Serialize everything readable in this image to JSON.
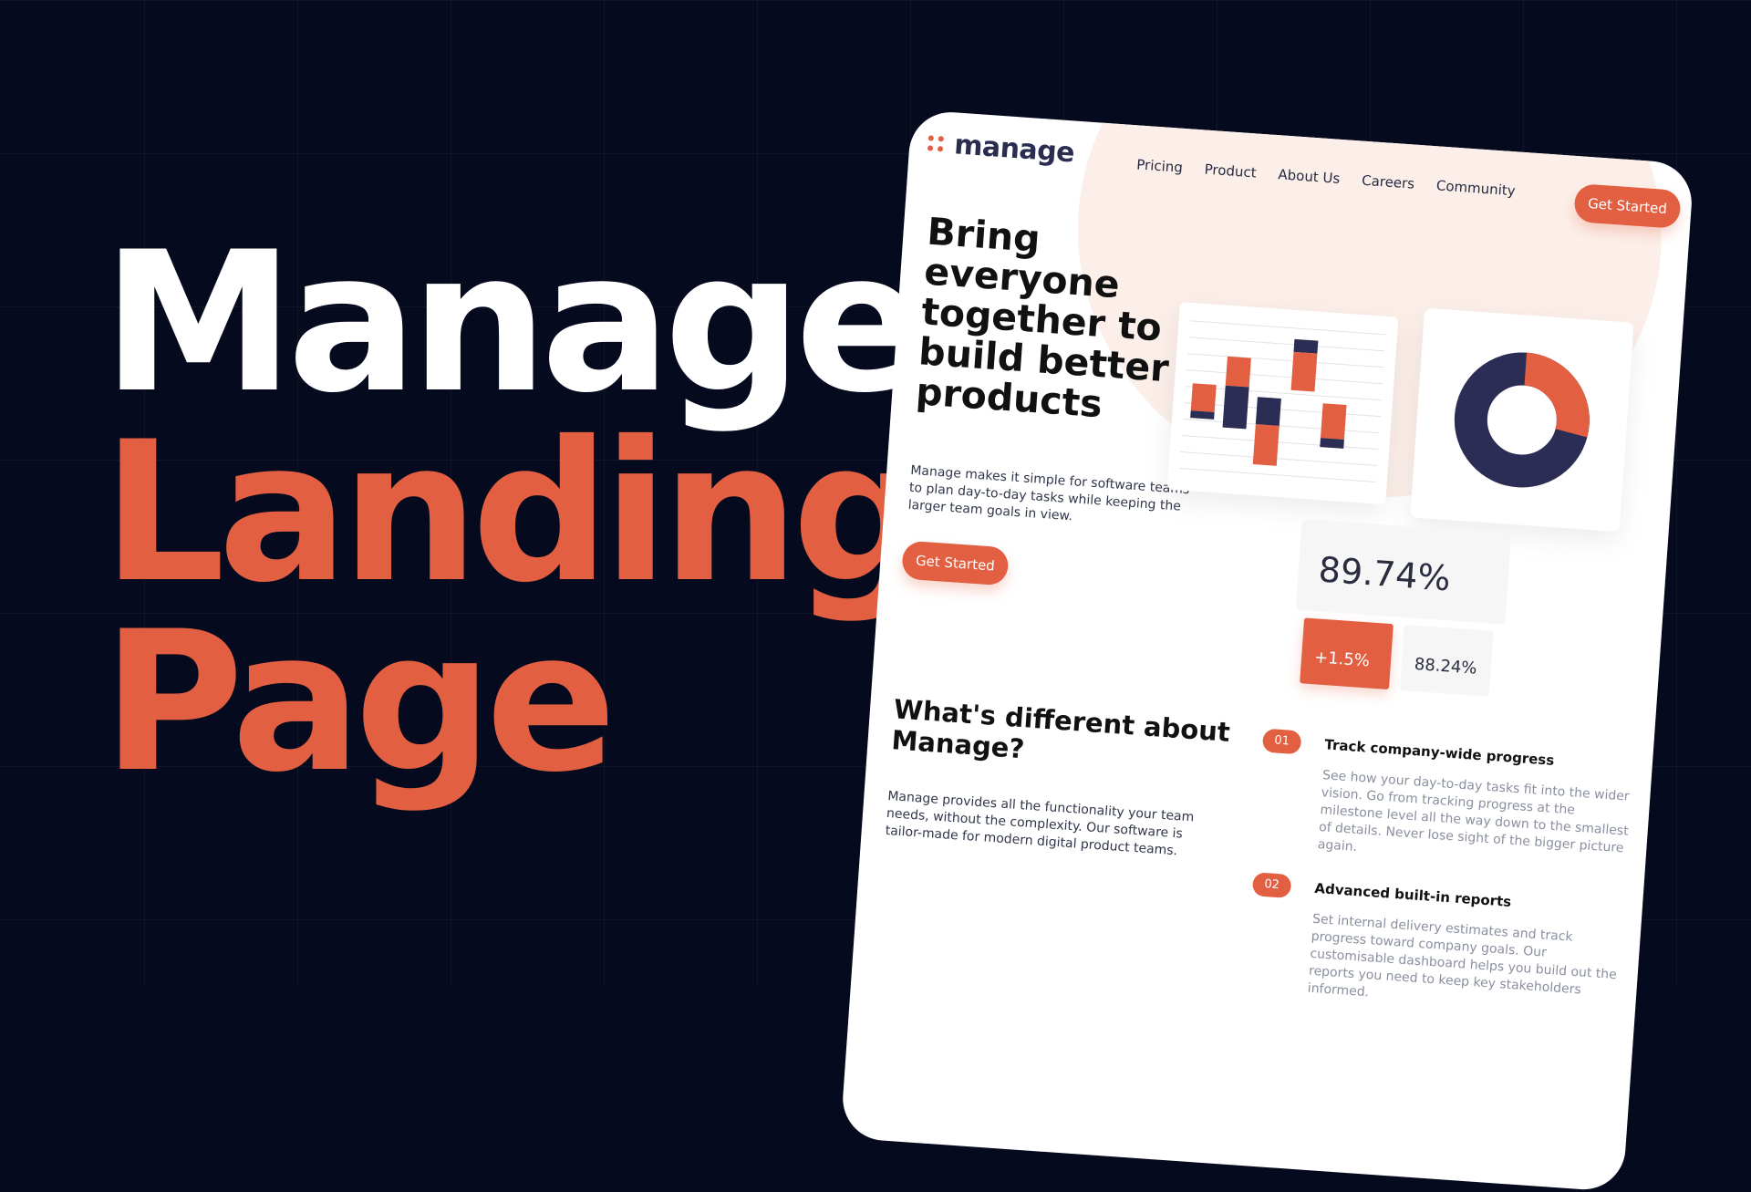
{
  "hero": {
    "line1": "Manage",
    "line2": "Landing",
    "line3": "Page"
  },
  "mockup": {
    "logo": "manage",
    "nav": [
      "Pricing",
      "Product",
      "About Us",
      "Careers",
      "Community"
    ],
    "cta_label": "Get Started",
    "headline": "Bring everyone together to build better products",
    "lead": "Manage makes it simple for software teams to plan day-to-day tasks while keeping the larger team goals in view.",
    "stats": {
      "main": "89.74%",
      "change": "+1.5%",
      "secondary": "88.24%"
    },
    "section_title": "What's different about Manage?",
    "section_lead": "Manage provides all the functionality your team needs, without the complexity. Our software is tailor-made for modern digital product teams.",
    "features": [
      {
        "num": "01",
        "title": "Track company-wide progress",
        "desc": "See how your day-to-day tasks fit into the wider vision. Go from tracking progress at the milestone level all the way down to the smallest of details. Never lose sight of the bigger picture again."
      },
      {
        "num": "02",
        "title": "Advanced built-in reports",
        "desc": "Set internal delivery estimates and track progress toward company goals. Our customisable dashboard helps you build out the reports you need to keep key stakeholders informed."
      }
    ],
    "donut": {
      "primary_fraction": 0.72,
      "accent_fraction": 0.28
    },
    "colors": {
      "accent": "#e25f41",
      "navy": "#2b2d55",
      "background": "#060a1e"
    }
  }
}
